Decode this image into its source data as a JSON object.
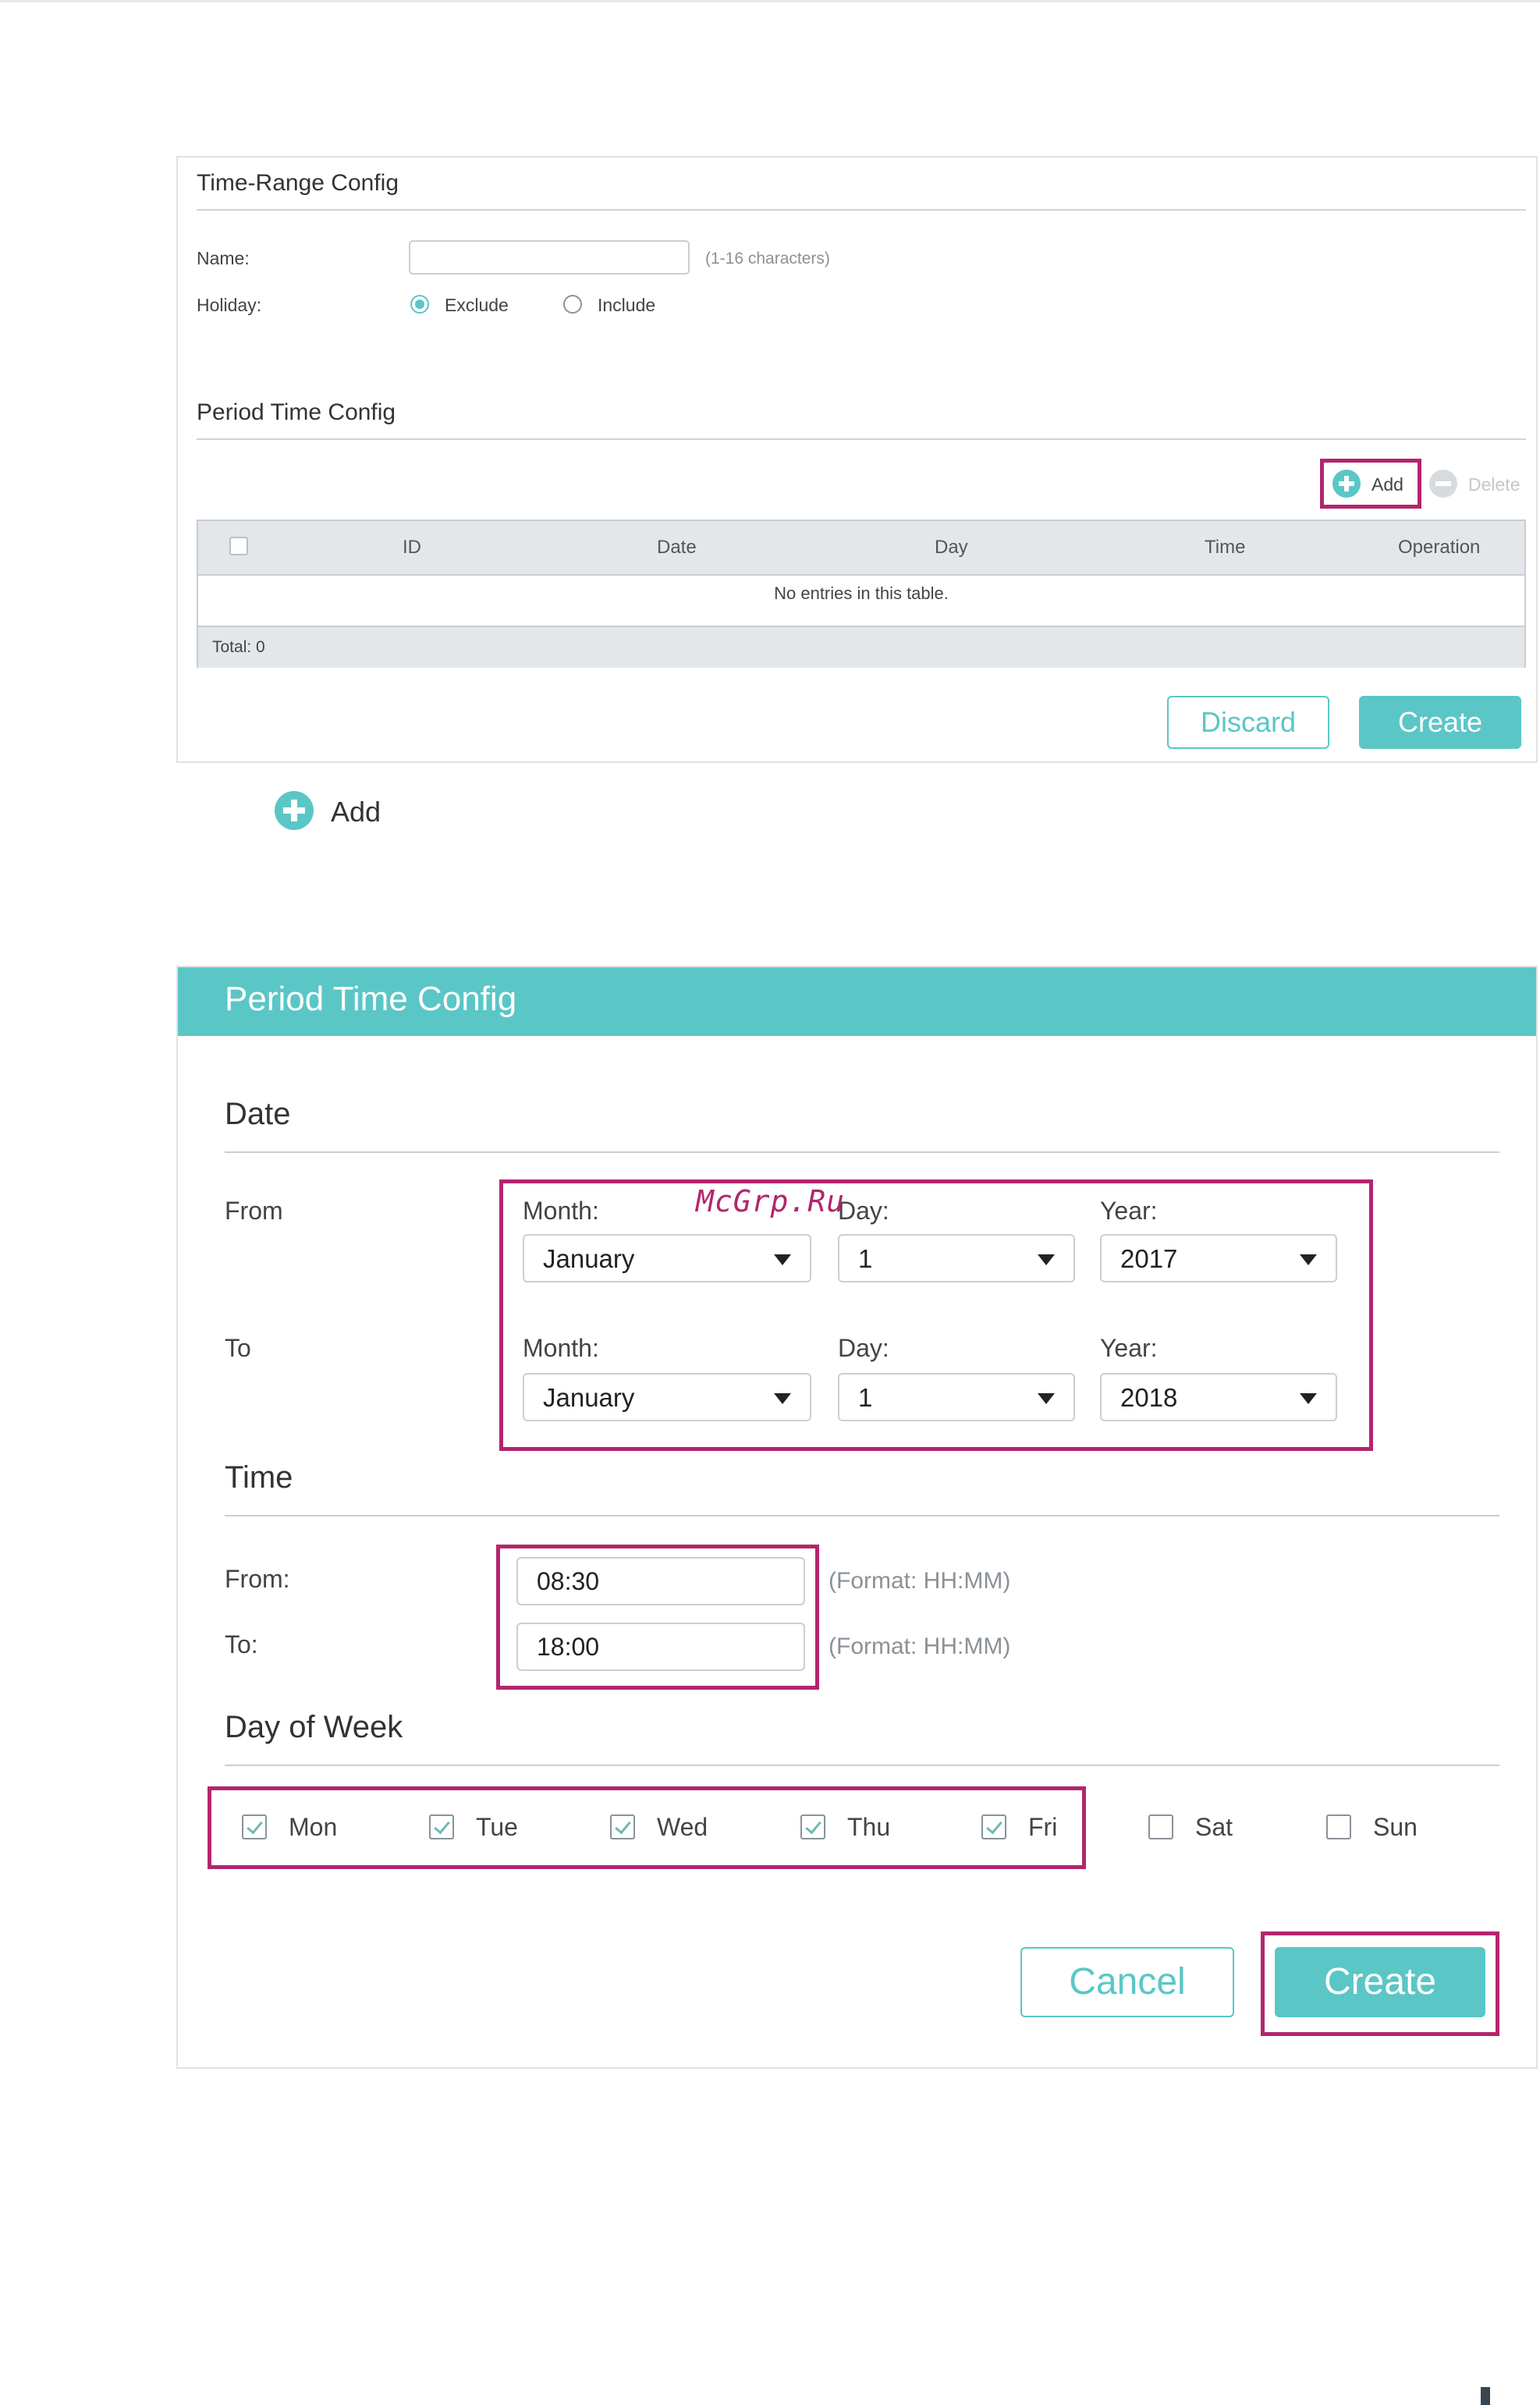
{
  "panel1": {
    "title": "Time-Range Config",
    "name_label": "Name:",
    "name_value": "",
    "name_hint": "(1-16 characters)",
    "holiday_label": "Holiday:",
    "holiday_options": [
      "Exclude",
      "Include"
    ],
    "holiday_selected": "Exclude",
    "section_title": "Period Time Config",
    "add_label": "Add",
    "delete_label": "Delete",
    "table": {
      "columns": [
        "ID",
        "Date",
        "Day",
        "Time",
        "Operation"
      ],
      "empty_text": "No entries in this table.",
      "total": "Total: 0"
    },
    "discard_label": "Discard",
    "create_label": "Create"
  },
  "add_caption": "Add",
  "panel2": {
    "header": "Period Time Config",
    "date_title": "Date",
    "from_label": "From",
    "to_label": "To",
    "month_label": "Month:",
    "day_label": "Day:",
    "year_label": "Year:",
    "from_month": "January",
    "from_day": "1",
    "from_year": "2017",
    "to_month": "January",
    "to_day": "1",
    "to_year": "2018",
    "time_title": "Time",
    "time_from_label": "From:",
    "time_to_label": "To:",
    "time_from": "08:30",
    "time_to": "18:00",
    "time_format": "(Format: HH:MM)",
    "dow_title": "Day of Week",
    "days": [
      {
        "label": "Mon",
        "checked": true
      },
      {
        "label": "Tue",
        "checked": true
      },
      {
        "label": "Wed",
        "checked": true
      },
      {
        "label": "Thu",
        "checked": true
      },
      {
        "label": "Fri",
        "checked": true
      },
      {
        "label": "Sat",
        "checked": false
      },
      {
        "label": "Sun",
        "checked": false
      }
    ],
    "cancel_label": "Cancel",
    "create_label": "Create"
  },
  "watermark": "McGrp.Ru",
  "colors": {
    "accent": "#5bc6c6",
    "highlight": "#b3256d"
  }
}
